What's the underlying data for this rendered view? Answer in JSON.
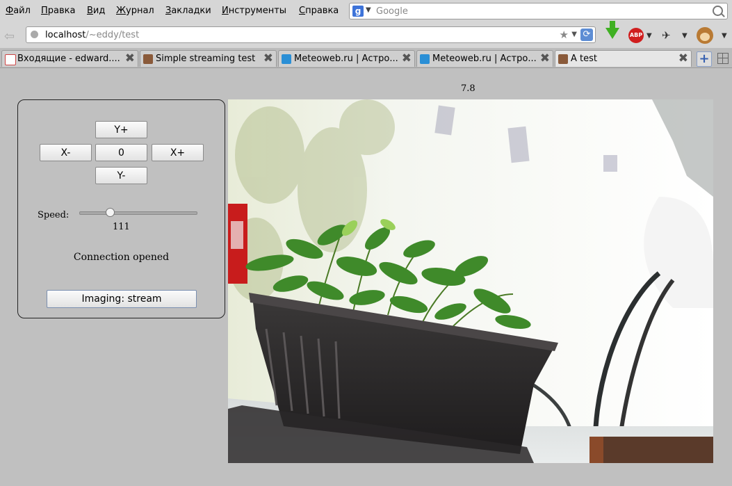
{
  "menubar": {
    "items": [
      "Файл",
      "Правка",
      "Вид",
      "Журнал",
      "Закладки",
      "Инструменты",
      "Справка"
    ],
    "search_placeholder": "Google"
  },
  "navbar": {
    "url_host": "localhost",
    "url_path": "/~eddy/test"
  },
  "tabs": [
    {
      "label": "Входящие - edward....",
      "icon": "gmail-icon",
      "active": false
    },
    {
      "label": "Simple streaming test",
      "icon": "favicon",
      "active": false
    },
    {
      "label": "Meteoweb.ru | Астро...",
      "icon": "meteoweb-icon",
      "active": false
    },
    {
      "label": "Meteoweb.ru | Астро...",
      "icon": "meteoweb-icon",
      "active": false
    },
    {
      "label": "A test",
      "icon": "favicon",
      "active": true
    }
  ],
  "page": {
    "top_value": "7.8",
    "controls": {
      "y_plus": "Y+",
      "x_minus": "X-",
      "zero": "0",
      "x_plus": "X+",
      "y_minus": "Y-"
    },
    "speed_label": "Speed:",
    "speed_value": "111",
    "speed_fraction": 0.24,
    "status": "Connection opened",
    "imaging_button": "Imaging: stream"
  },
  "colors": {
    "chrome_bg": "#d6d6d6",
    "page_bg": "#c0c0c0",
    "plant_green": "#3f8a2a",
    "pot_dark": "#2c2a2b"
  }
}
